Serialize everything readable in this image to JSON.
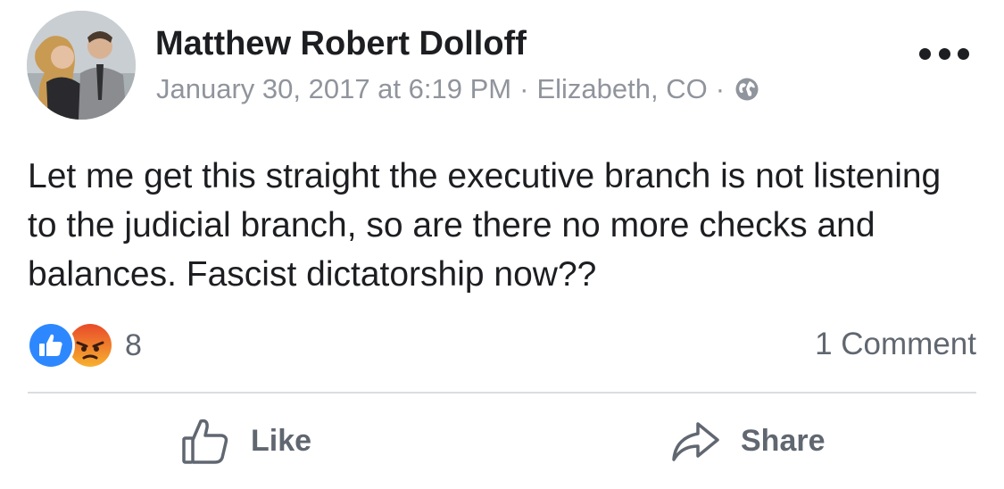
{
  "post": {
    "author": "Matthew Robert Dolloff",
    "date": "January 30, 2017 at 6:19 PM",
    "separator": "·",
    "location": "Elizabeth, CO",
    "privacy_icon": "globe-icon",
    "more_icon": "ellipsis-icon",
    "text": "Let me get this straight the executive branch is not listening to the judicial branch, so are there no more checks and balances. Fascist dictatorship now??"
  },
  "stats": {
    "reaction_icons": [
      "like-reaction-icon",
      "angry-reaction-icon"
    ],
    "reaction_count": "8",
    "comments": "1 Comment"
  },
  "actions": {
    "like_label": "Like",
    "share_label": "Share"
  },
  "colors": {
    "text": "#1c1e21",
    "muted": "#90949c",
    "action": "#606770",
    "like_blue": "#2d88ff",
    "angry_orange": "#f06f2b",
    "divider": "#dadde1"
  }
}
